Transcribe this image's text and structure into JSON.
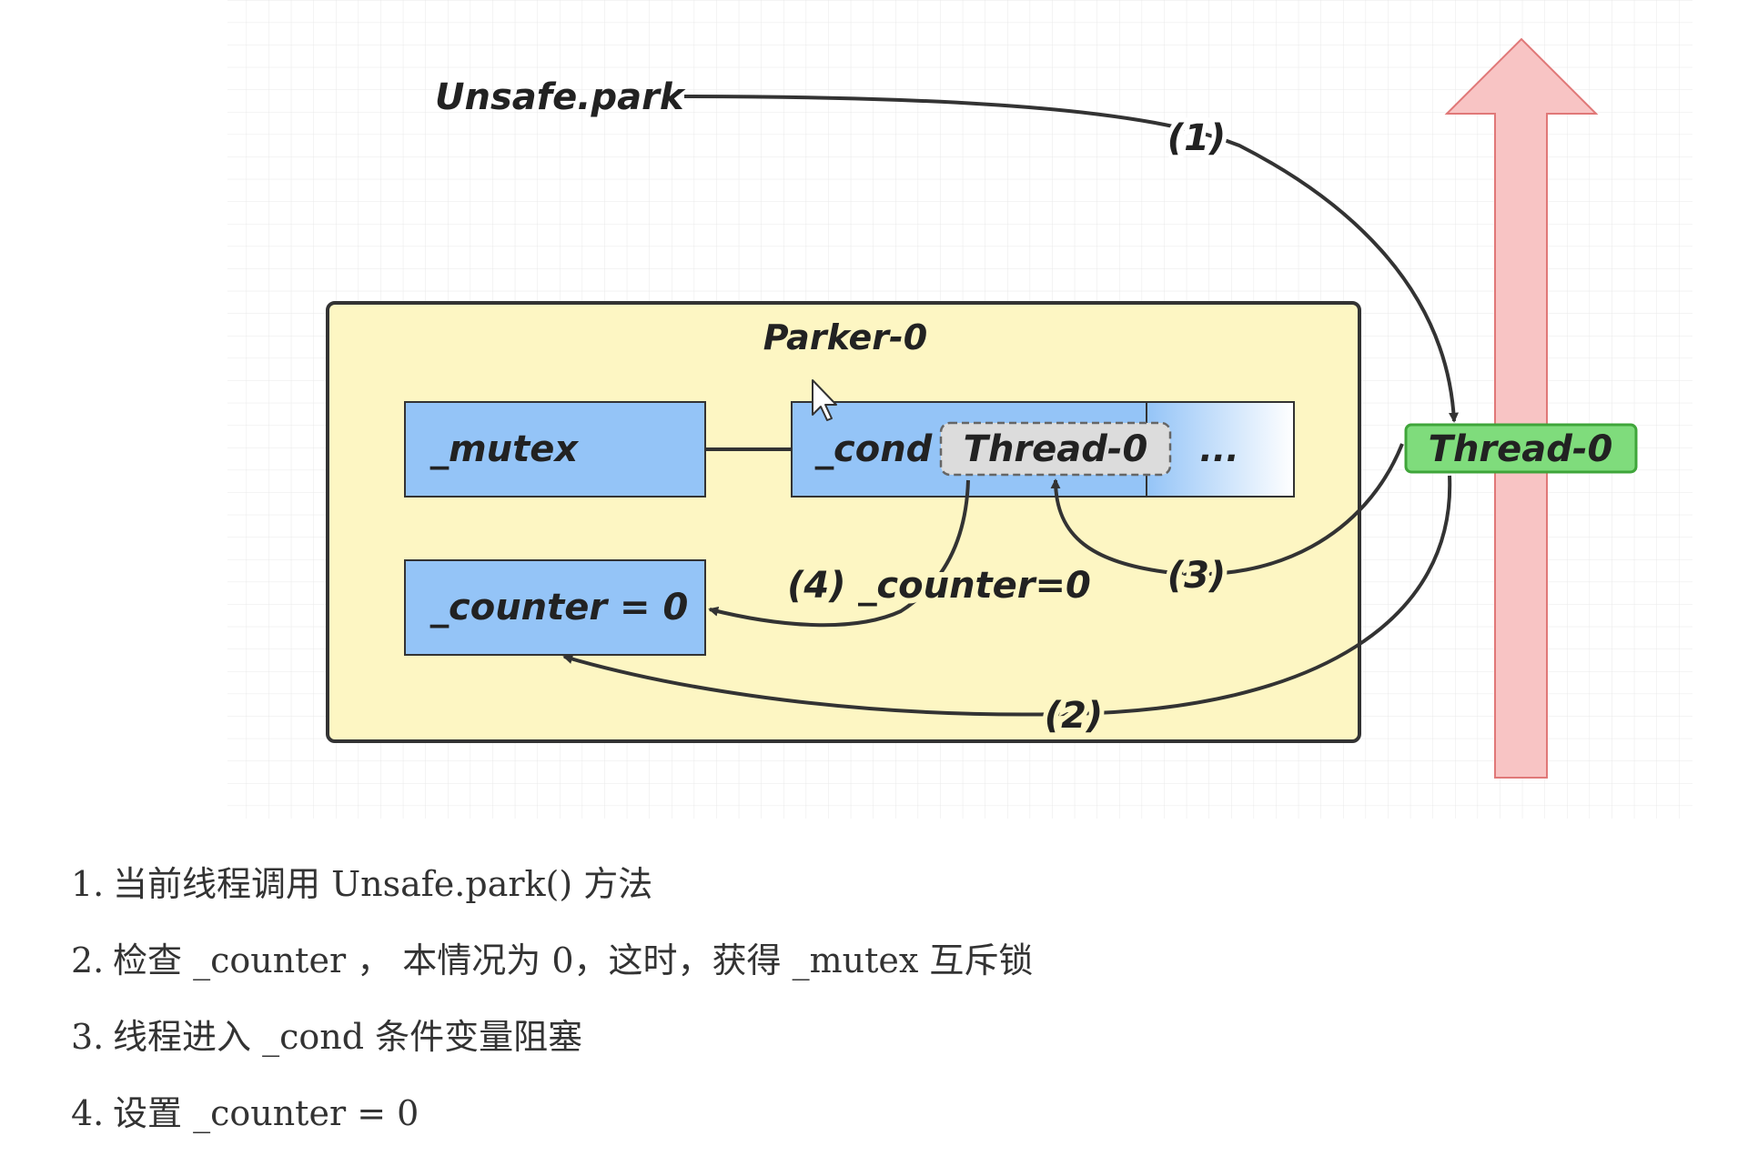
{
  "diagram": {
    "unsafe_park_label": "Unsafe.park",
    "parker_title": "Parker-0",
    "mutex_label": "_mutex",
    "cond_label": "_cond",
    "cond_waiting_thread": "Thread-0",
    "cond_more": "...",
    "counter_label": "_counter = 0",
    "thread_label": "Thread-0",
    "step1_marker": "(1)",
    "step2_marker": "(2)",
    "step3_marker": "(3)",
    "step4_marker": "(4) _counter=0",
    "colors": {
      "parker_fill": "#fdf6c3",
      "slot_fill": "#94c4f7",
      "thread_fill": "#7fdc7c",
      "thread_stroke": "#3fa53a",
      "timeline_fill": "#f8c4c4",
      "timeline_stroke": "#e07878",
      "grid": "#e8e8e8"
    }
  },
  "steps": [
    {
      "number": "1.",
      "text": "当前线程调用 Unsafe.park() 方法"
    },
    {
      "number": "2.",
      "text": "检查 _counter ， 本情况为 0，这时，获得 _mutex 互斥锁"
    },
    {
      "number": "3.",
      "text": "线程进入 _cond 条件变量阻塞"
    },
    {
      "number": "4.",
      "text": "设置 _counter = 0"
    }
  ]
}
